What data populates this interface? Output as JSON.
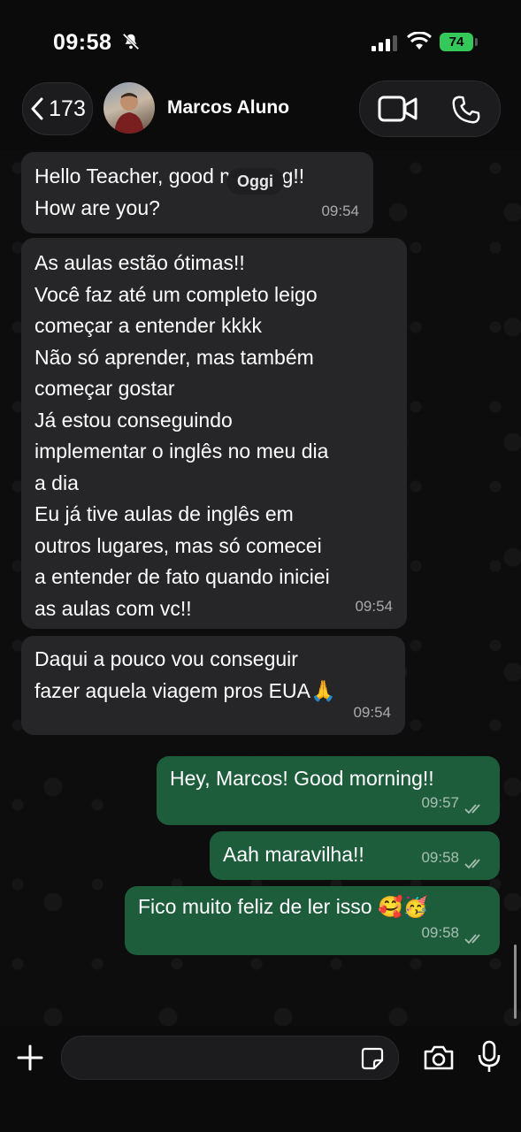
{
  "status_bar": {
    "time": "09:58",
    "battery": "74"
  },
  "header": {
    "back_count": "173",
    "contact_name": "Marcos Aluno"
  },
  "date_chip": "Oggi",
  "messages": {
    "m1": {
      "text": "Hello Teacher, good morning!!\nHow are you?",
      "time": "09:54"
    },
    "m2": {
      "text": "As aulas estão ótimas!!\nVocê faz até um completo leigo\ncomeçar a entender kkkk\nNão só aprender, mas também\ncomeçar gostar\nJá estou conseguindo\nimplementar o inglês no meu dia\na dia\nEu já tive aulas de inglês em\noutros lugares, mas só comecei\na entender de fato quando iniciei\nas aulas com vc!!",
      "time": "09:54"
    },
    "m3": {
      "text": "Daqui a pouco vou conseguir\nfazer aquela viagem pros EUA🙏",
      "time": "09:54"
    },
    "m4": {
      "text": "Hey, Marcos! Good morning!!",
      "time": "09:57"
    },
    "m5": {
      "text": "Aah maravilha!!",
      "time": "09:58"
    },
    "m6": {
      "text": "Fico muito feliz de ler isso 🥰🥳",
      "time": "09:58"
    }
  },
  "colors": {
    "incoming": "#262628",
    "outgoing": "#1e5d3c",
    "battery": "#34c759"
  }
}
